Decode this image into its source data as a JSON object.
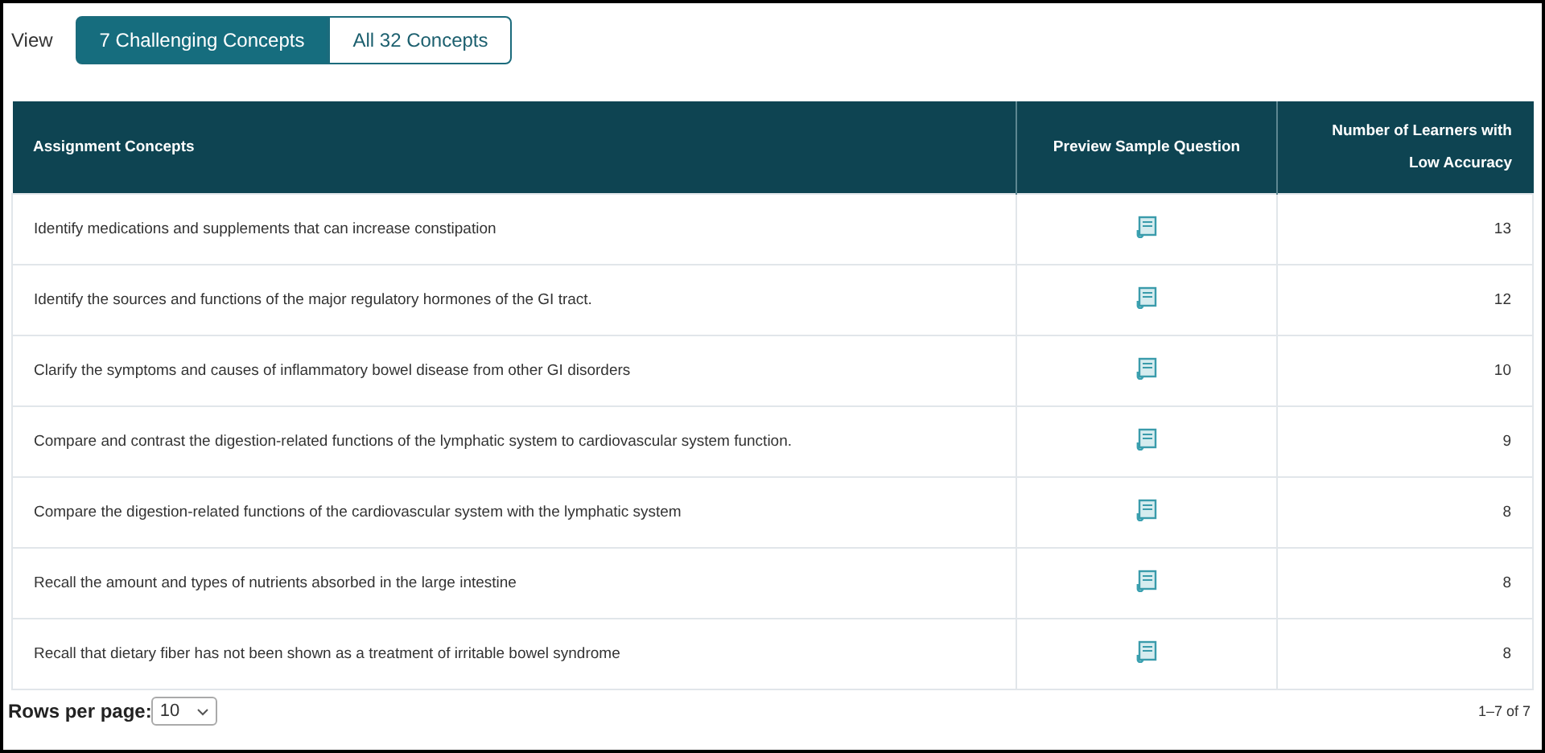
{
  "view": {
    "label": "View",
    "options": [
      {
        "label": "7 Challenging Concepts",
        "selected": true
      },
      {
        "label": "All 32 Concepts",
        "selected": false
      }
    ]
  },
  "table": {
    "columns": [
      "Assignment Concepts",
      "Preview Sample Question",
      "Number of Learners with Low Accuracy"
    ],
    "rows": [
      {
        "concept": "Identify medications and supplements that can increase constipation",
        "learners": "13"
      },
      {
        "concept": "Identify the sources and functions of the major regulatory hormones of the GI tract.",
        "learners": "12"
      },
      {
        "concept": "Clarify the symptoms and causes of inflammatory bowel disease from other GI disorders",
        "learners": "10"
      },
      {
        "concept": "Compare and contrast the digestion-related functions of the lymphatic system to cardiovascular system function.",
        "learners": "9"
      },
      {
        "concept": "Compare the digestion-related functions of the cardiovascular system with the lymphatic system",
        "learners": "8"
      },
      {
        "concept": "Recall the amount and types of nutrients absorbed in the large intestine",
        "learners": "8"
      },
      {
        "concept": "Recall that dietary fiber has not been shown as a treatment of irritable bowel syndrome",
        "learners": "8"
      }
    ]
  },
  "footer": {
    "rows_per_page_label": "Rows per page:",
    "rows_per_page": "10",
    "range": "1–7 of 7"
  }
}
